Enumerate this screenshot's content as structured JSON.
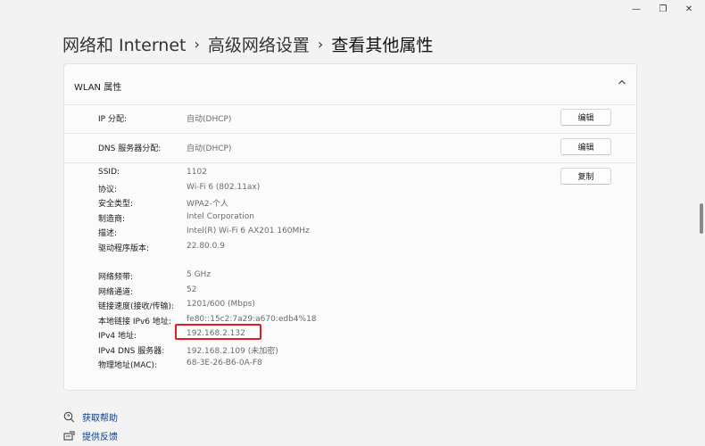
{
  "window": {
    "minimize_glyph": "—",
    "maximize_glyph": "❐",
    "close_glyph": "✕"
  },
  "breadcrumb": {
    "root": "网络和 Internet",
    "parent": "高级网络设置",
    "current": "查看其他属性",
    "separator": "›"
  },
  "card": {
    "title": "WLAN 属性",
    "expanded": true
  },
  "ip_section": {
    "label": "IP 分配:",
    "value": "自动(DHCP)",
    "button": "编辑"
  },
  "dns_section": {
    "label": "DNS 服务器分配:",
    "value": "自动(DHCP)",
    "button": "编辑"
  },
  "details": {
    "copy_button": "复制",
    "rows": [
      {
        "label": "SSID:",
        "value": "1102"
      },
      {
        "label": "协议:",
        "value": "Wi-Fi 6 (802.11ax)"
      },
      {
        "label": "安全类型:",
        "value": "WPA2-个人"
      },
      {
        "label": "制造商:",
        "value": "Intel Corporation"
      },
      {
        "label": "描述:",
        "value": "Intel(R) Wi-Fi 6 AX201 160MHz"
      },
      {
        "label": "驱动程序版本:",
        "value": "22.80.0.9"
      },
      {
        "label": "网络频带:",
        "value": "5 GHz"
      },
      {
        "label": "网络通道:",
        "value": "52"
      },
      {
        "label": "链接速度(接收/传输):",
        "value": "1201/600 (Mbps)"
      },
      {
        "label": "本地链接 IPv6 地址:",
        "value": "fe80::15c2:7a29:a670:edb4%18"
      },
      {
        "label": "IPv4 地址:",
        "value": "192.168.2.132"
      },
      {
        "label": "IPv4 DNS 服务器:",
        "value": "192.168.2.109 (未加密)"
      },
      {
        "label": "物理地址(MAC):",
        "value": "68-3E-26-B6-0A-F8"
      }
    ]
  },
  "footer_links": {
    "help": "获取帮助",
    "feedback": "提供反馈"
  },
  "colors": {
    "accent_link": "#0a3d8f",
    "highlight_border": "#e31b23",
    "background": "#f3f3f3",
    "card": "#fbfbfb"
  }
}
